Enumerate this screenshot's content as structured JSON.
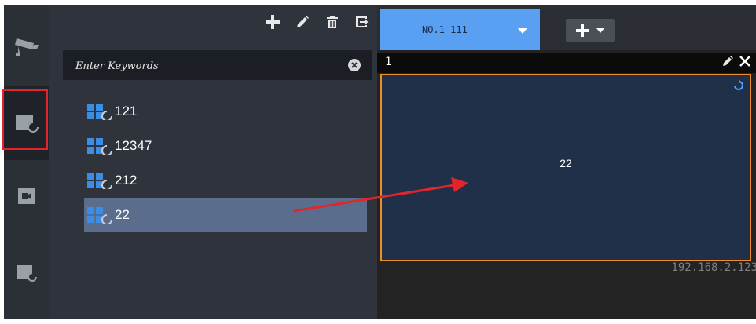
{
  "toolbar": {
    "add": "add-icon",
    "edit": "pencil-icon",
    "delete": "trash-icon",
    "export": "export-icon"
  },
  "search": {
    "placeholder": "Enter Keywords"
  },
  "groups": [
    {
      "label": "121",
      "selected": false
    },
    {
      "label": "12347",
      "selected": false
    },
    {
      "label": "212",
      "selected": false
    },
    {
      "label": "22",
      "selected": true
    }
  ],
  "tab": {
    "label": "NO.1 111"
  },
  "window": {
    "number": "1",
    "channel_name": "22",
    "ip": "192.168.2.123"
  },
  "colors": {
    "accent": "#5aa0f2",
    "selection": "#5a6d8c",
    "window_border": "#f08b2a",
    "highlight": "#e0262b"
  }
}
